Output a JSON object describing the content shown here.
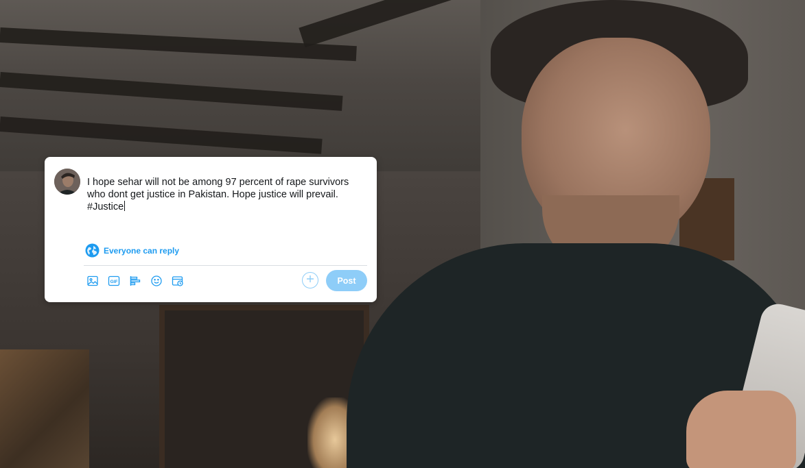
{
  "compose": {
    "tweet_text": "I hope sehar will not be among 97 percent of rape survivors who dont get justice in Pakistan. Hope justice will prevail. #Justice",
    "reply_setting": "Everyone can reply",
    "post_label": "Post"
  },
  "toolbar": {
    "icons": [
      "image-icon",
      "gif-icon",
      "poll-icon",
      "emoji-icon",
      "schedule-icon"
    ],
    "gif_text": "GIF"
  },
  "colors": {
    "accent": "#1d9bf0",
    "accent_disabled": "#8ecdf8",
    "text": "#14171a",
    "divider": "#d8dde1"
  }
}
